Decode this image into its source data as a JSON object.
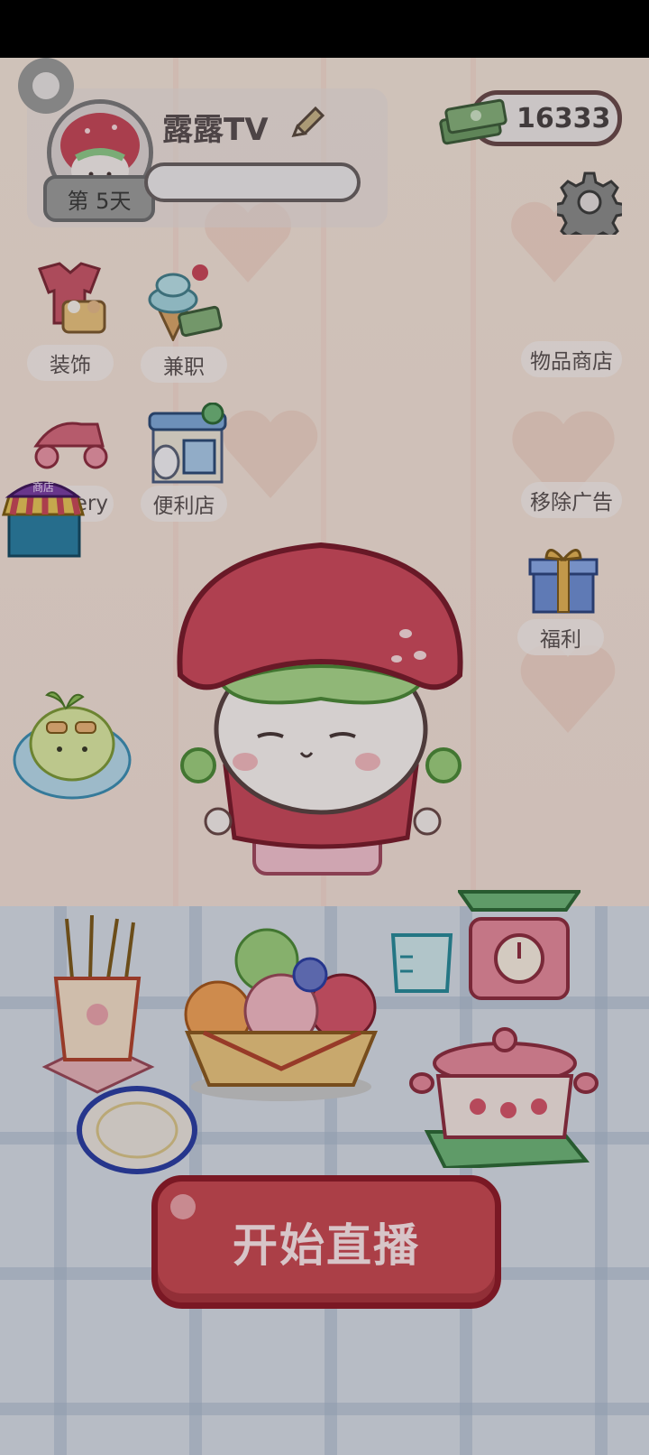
{
  "profile": {
    "name": "露露TV",
    "day_label": "第 5天"
  },
  "currency": {
    "amount": "16333"
  },
  "menu": {
    "left": [
      {
        "label": "装饰",
        "icon": "outfit-icon"
      },
      {
        "label": "兼职",
        "icon": "ice-cream-icon"
      },
      {
        "label": "ery",
        "icon": "scooter-icon"
      },
      {
        "label": "便利店",
        "icon": "convenience-store-icon"
      }
    ],
    "right": [
      {
        "label": "物品商店",
        "icon": "item-shop-icon"
      },
      {
        "label": "移除广告",
        "icon": "remove-ads-icon"
      },
      {
        "label": "福利",
        "icon": "gift-icon"
      }
    ],
    "shop_tag": "商店"
  },
  "start_button": {
    "label": "开始直播"
  },
  "colors": {
    "accent": "#c74a53",
    "dark_outline": "#8f1d2a",
    "overlay": "rgba(0,0,0,0.35)"
  }
}
